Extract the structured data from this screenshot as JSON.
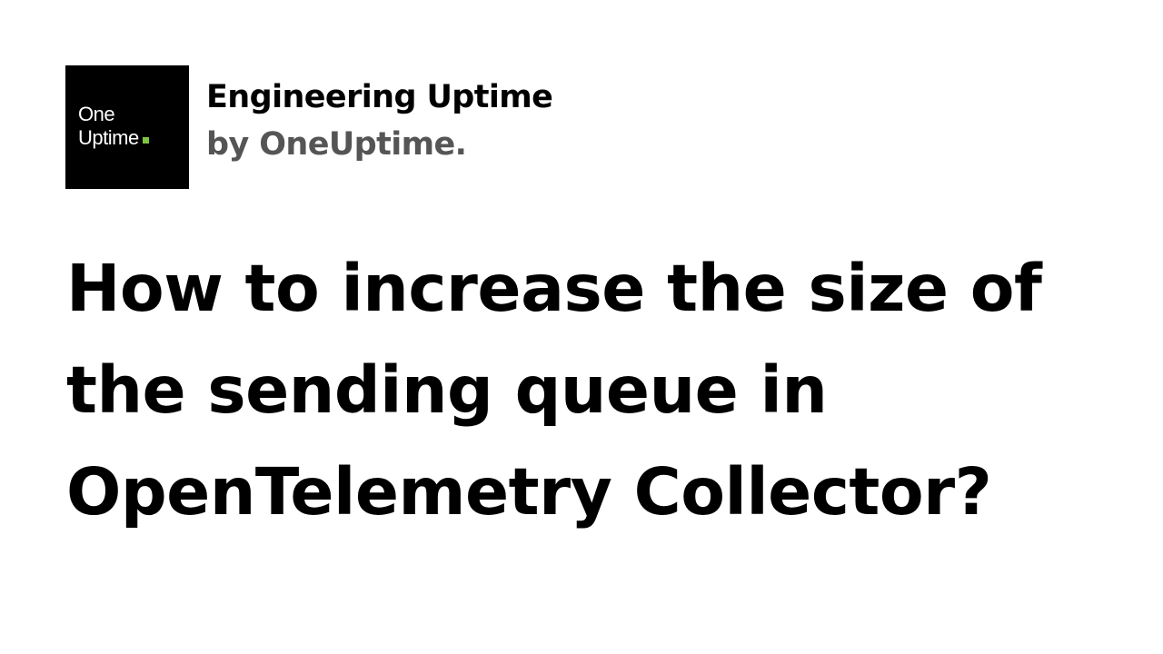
{
  "logo": {
    "line1": "One",
    "line2": "Uptime",
    "dot_color": "#7ec544"
  },
  "brand": {
    "title": "Engineering Uptime",
    "subtitle": "by OneUptime."
  },
  "headline": {
    "lines": [
      "How to increase the size of",
      "the sending queue in",
      "OpenTelemetry Collector?"
    ]
  },
  "colors": {
    "background": "#ffffff",
    "text": "#000000",
    "subtitle": "#555555",
    "logo_background": "#000000"
  }
}
